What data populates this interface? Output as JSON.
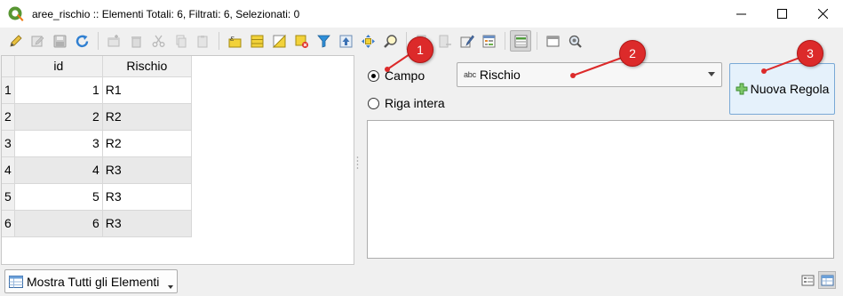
{
  "window": {
    "title": "aree_rischio :: Elementi Totali: 6, Filtrati: 6, Selezionati: 0",
    "icon": "qgis-icon",
    "controls": [
      "minimize-icon",
      "maximize-icon",
      "close-icon"
    ]
  },
  "toolbar": {
    "icons": [
      "pencil-toggle-edit-icon",
      "multi-edit-icon",
      "save-edits-icon",
      "reload-icon",
      "add-feature-icon",
      "delete-feature-icon",
      "cut-icon",
      "copy-icon",
      "paste-icon",
      "select-expression-icon",
      "select-all-icon",
      "invert-selection-icon",
      "deselect-all-icon",
      "filter-icon",
      "move-selection-top-icon",
      "pan-to-selection-icon",
      "zoom-to-selection-icon",
      "new-field-icon",
      "delete-field-icon",
      "field-calculator-icon",
      "conditional-formatting-icon",
      "dock-attribute-table-icon",
      "actions-icon"
    ]
  },
  "table": {
    "headers": [
      "id",
      "Rischio"
    ],
    "rows": [
      {
        "num": "1",
        "id": "1",
        "rischio": "R1"
      },
      {
        "num": "2",
        "id": "2",
        "rischio": "R2"
      },
      {
        "num": "3",
        "id": "3",
        "rischio": "R2"
      },
      {
        "num": "4",
        "id": "4",
        "rischio": "R3"
      },
      {
        "num": "5",
        "id": "5",
        "rischio": "R3"
      },
      {
        "num": "6",
        "id": "6",
        "rischio": "R3"
      }
    ]
  },
  "format_panel": {
    "radio_field_label": "Campo",
    "radio_row_label": "Riga intera",
    "selected_radio": "Campo",
    "field_type_badge": "abc",
    "field_select_value": "Rischio",
    "new_rule_label": "Nuova Regola"
  },
  "bottom_bar": {
    "show_all_label": "Mostra Tutti gli Elementi"
  },
  "callouts": [
    "1",
    "2",
    "3"
  ],
  "colors": {
    "callout_red": "#dc2a2a",
    "button_highlight": "#e5f1fb",
    "qgis_green": "#589632"
  }
}
